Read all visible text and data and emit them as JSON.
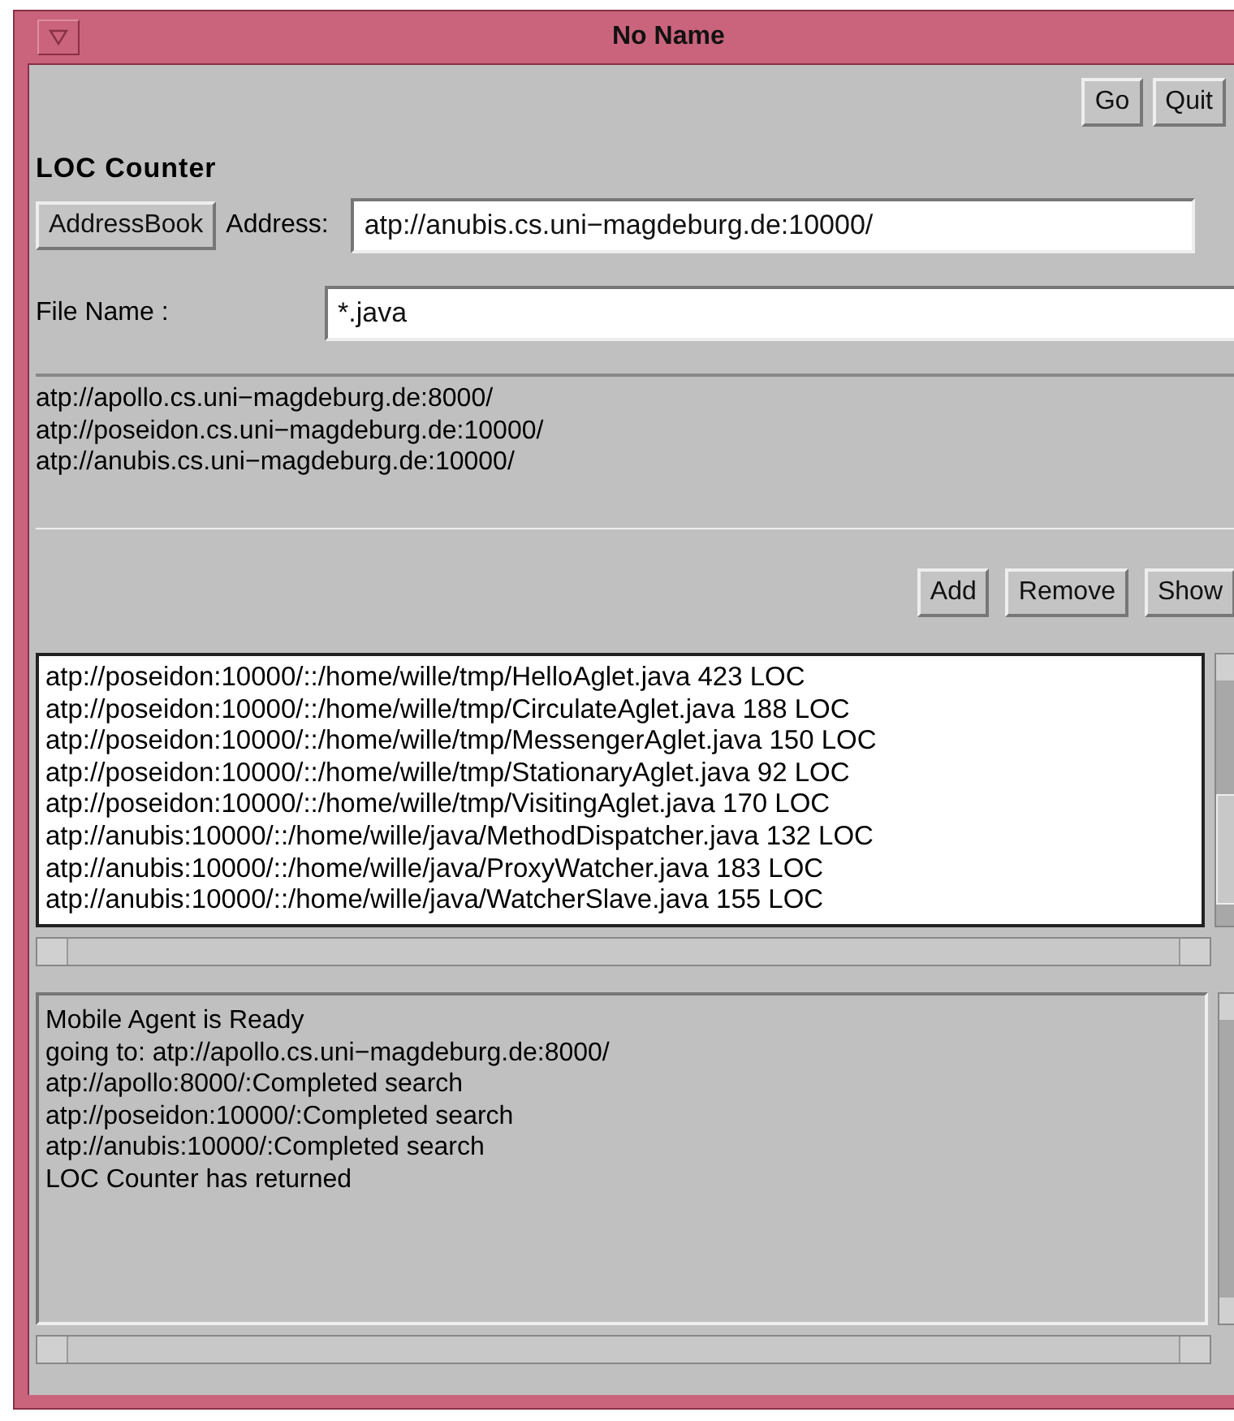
{
  "window": {
    "title": "No Name"
  },
  "top_buttons": [
    "Go",
    "Quit"
  ],
  "heading": "LOC Counter",
  "address": {
    "button": "AddressBook",
    "label": "Address:",
    "value": "atp://anubis.cs.uni−magdeburg.de:10000/"
  },
  "file_name": {
    "label": "File Name :",
    "value": "*.java"
  },
  "address_list": [
    "atp://apollo.cs.uni−magdeburg.de:8000/",
    "atp://poseidon.cs.uni−magdeburg.de:10000/",
    "atp://anubis.cs.uni−magdeburg.de:10000/"
  ],
  "list_buttons": [
    "Add",
    "Remove",
    "Show"
  ],
  "results": [
    "atp://poseidon:10000/::/home/wille/tmp/HelloAglet.java 423 LOC",
    "atp://poseidon:10000/::/home/wille/tmp/CirculateAglet.java 188 LOC",
    "atp://poseidon:10000/::/home/wille/tmp/MessengerAglet.java 150 LOC",
    "atp://poseidon:10000/::/home/wille/tmp/StationaryAglet.java 92 LOC",
    "atp://poseidon:10000/::/home/wille/tmp/VisitingAglet.java 170 LOC",
    "atp://anubis:10000/::/home/wille/java/MethodDispatcher.java 132 LOC",
    "atp://anubis:10000/::/home/wille/java/ProxyWatcher.java 183 LOC",
    "atp://anubis:10000/::/home/wille/java/WatcherSlave.java 155 LOC"
  ],
  "log": [
    "Mobile Agent is Ready",
    "going to: atp://apollo.cs.uni−magdeburg.de:8000/",
    "atp://apollo:8000/:Completed search",
    "atp://poseidon:10000/:Completed search",
    "atp://anubis:10000/:Completed search",
    "LOC Counter has returned"
  ]
}
